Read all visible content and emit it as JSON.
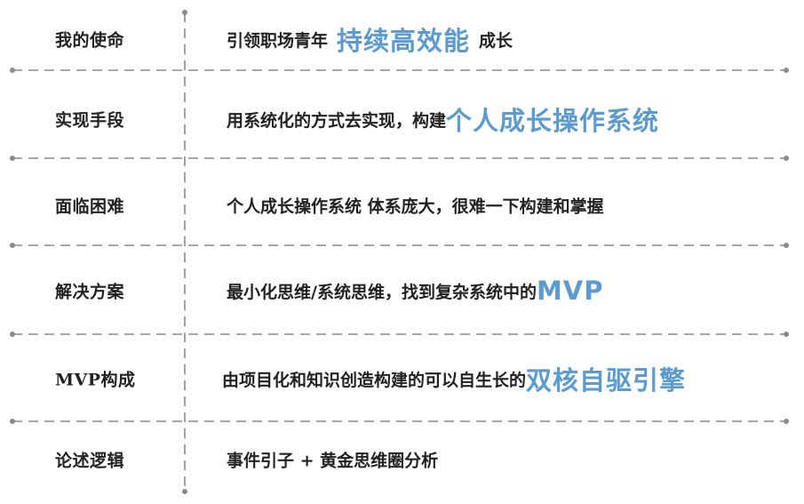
{
  "rows": [
    {
      "label": "我的使命",
      "text_before": "引领职场青年",
      "highlight": "持续高效能",
      "text_after": "成长"
    },
    {
      "label": "实现手段",
      "text_before": "用系统化的方式去实现，构建",
      "highlight": "个人成长操作系统",
      "text_after": ""
    },
    {
      "label": "面临困难",
      "text_before": "个人成长操作系统 体系庞大，很难一下构建和掌握",
      "highlight": "",
      "text_after": ""
    },
    {
      "label": "解决方案",
      "text_before": "最小化思维/系统思维，找到复杂系统中的",
      "highlight": "MVP",
      "text_after": ""
    },
    {
      "label": "MVP构成",
      "text_before": "由项目化和知识创造构建的可以自生长的",
      "highlight": "双核自驱引擎",
      "text_after": ""
    },
    {
      "label": "论述逻辑",
      "text_before": "事件引子 + 黄金思维圈分析",
      "highlight": "",
      "text_after": ""
    }
  ],
  "colors": {
    "highlight": "#5b9bd0",
    "line": "#8a8a8a",
    "text": "#222222"
  }
}
